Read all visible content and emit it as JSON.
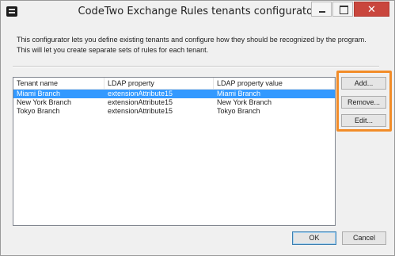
{
  "window": {
    "title": "CodeTwo Exchange Rules tenants configurator",
    "close_glyph": "✕",
    "icons": {
      "app": "app-icon",
      "minimize": "minimize-icon",
      "maximize": "maximize-icon",
      "close": "close-icon"
    }
  },
  "description": "This configurator lets you define existing tenants and configure how they should be recognized by the program. This will let you create separate sets of rules for each tenant.",
  "table": {
    "headers": [
      "Tenant name",
      "LDAP property",
      "LDAP property value"
    ],
    "rows": [
      {
        "name": "Miami Branch",
        "property": "extensionAttribute15",
        "value": "Miami Branch",
        "selected": true
      },
      {
        "name": "New York Branch",
        "property": "extensionAttribute15",
        "value": "New York Branch",
        "selected": false
      },
      {
        "name": "Tokyo Branch",
        "property": "extensionAttribute15",
        "value": "Tokyo Branch",
        "selected": false
      }
    ]
  },
  "actions": {
    "add": "Add...",
    "remove": "Remove...",
    "edit": "Edit..."
  },
  "footer": {
    "ok": "OK",
    "cancel": "Cancel"
  },
  "colors": {
    "selection": "#3399ff",
    "highlight": "#f28c28",
    "close_button": "#c9463d"
  }
}
